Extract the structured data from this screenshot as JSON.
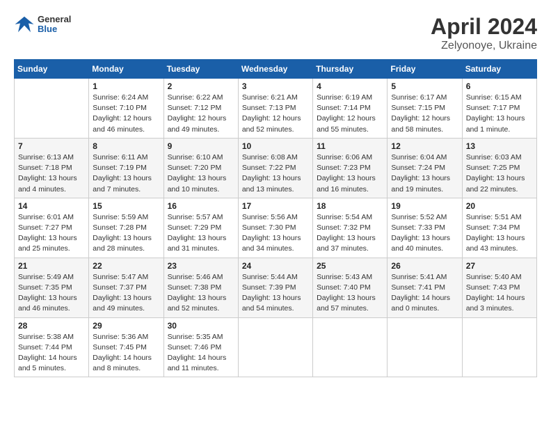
{
  "header": {
    "logo_line1": "General",
    "logo_line2": "Blue",
    "title": "April 2024",
    "subtitle": "Zelyonoye, Ukraine"
  },
  "weekdays": [
    "Sunday",
    "Monday",
    "Tuesday",
    "Wednesday",
    "Thursday",
    "Friday",
    "Saturday"
  ],
  "weeks": [
    [
      {
        "num": "",
        "detail": ""
      },
      {
        "num": "1",
        "detail": "Sunrise: 6:24 AM\nSunset: 7:10 PM\nDaylight: 12 hours\nand 46 minutes."
      },
      {
        "num": "2",
        "detail": "Sunrise: 6:22 AM\nSunset: 7:12 PM\nDaylight: 12 hours\nand 49 minutes."
      },
      {
        "num": "3",
        "detail": "Sunrise: 6:21 AM\nSunset: 7:13 PM\nDaylight: 12 hours\nand 52 minutes."
      },
      {
        "num": "4",
        "detail": "Sunrise: 6:19 AM\nSunset: 7:14 PM\nDaylight: 12 hours\nand 55 minutes."
      },
      {
        "num": "5",
        "detail": "Sunrise: 6:17 AM\nSunset: 7:15 PM\nDaylight: 12 hours\nand 58 minutes."
      },
      {
        "num": "6",
        "detail": "Sunrise: 6:15 AM\nSunset: 7:17 PM\nDaylight: 13 hours\nand 1 minute."
      }
    ],
    [
      {
        "num": "7",
        "detail": "Sunrise: 6:13 AM\nSunset: 7:18 PM\nDaylight: 13 hours\nand 4 minutes."
      },
      {
        "num": "8",
        "detail": "Sunrise: 6:11 AM\nSunset: 7:19 PM\nDaylight: 13 hours\nand 7 minutes."
      },
      {
        "num": "9",
        "detail": "Sunrise: 6:10 AM\nSunset: 7:20 PM\nDaylight: 13 hours\nand 10 minutes."
      },
      {
        "num": "10",
        "detail": "Sunrise: 6:08 AM\nSunset: 7:22 PM\nDaylight: 13 hours\nand 13 minutes."
      },
      {
        "num": "11",
        "detail": "Sunrise: 6:06 AM\nSunset: 7:23 PM\nDaylight: 13 hours\nand 16 minutes."
      },
      {
        "num": "12",
        "detail": "Sunrise: 6:04 AM\nSunset: 7:24 PM\nDaylight: 13 hours\nand 19 minutes."
      },
      {
        "num": "13",
        "detail": "Sunrise: 6:03 AM\nSunset: 7:25 PM\nDaylight: 13 hours\nand 22 minutes."
      }
    ],
    [
      {
        "num": "14",
        "detail": "Sunrise: 6:01 AM\nSunset: 7:27 PM\nDaylight: 13 hours\nand 25 minutes."
      },
      {
        "num": "15",
        "detail": "Sunrise: 5:59 AM\nSunset: 7:28 PM\nDaylight: 13 hours\nand 28 minutes."
      },
      {
        "num": "16",
        "detail": "Sunrise: 5:57 AM\nSunset: 7:29 PM\nDaylight: 13 hours\nand 31 minutes."
      },
      {
        "num": "17",
        "detail": "Sunrise: 5:56 AM\nSunset: 7:30 PM\nDaylight: 13 hours\nand 34 minutes."
      },
      {
        "num": "18",
        "detail": "Sunrise: 5:54 AM\nSunset: 7:32 PM\nDaylight: 13 hours\nand 37 minutes."
      },
      {
        "num": "19",
        "detail": "Sunrise: 5:52 AM\nSunset: 7:33 PM\nDaylight: 13 hours\nand 40 minutes."
      },
      {
        "num": "20",
        "detail": "Sunrise: 5:51 AM\nSunset: 7:34 PM\nDaylight: 13 hours\nand 43 minutes."
      }
    ],
    [
      {
        "num": "21",
        "detail": "Sunrise: 5:49 AM\nSunset: 7:35 PM\nDaylight: 13 hours\nand 46 minutes."
      },
      {
        "num": "22",
        "detail": "Sunrise: 5:47 AM\nSunset: 7:37 PM\nDaylight: 13 hours\nand 49 minutes."
      },
      {
        "num": "23",
        "detail": "Sunrise: 5:46 AM\nSunset: 7:38 PM\nDaylight: 13 hours\nand 52 minutes."
      },
      {
        "num": "24",
        "detail": "Sunrise: 5:44 AM\nSunset: 7:39 PM\nDaylight: 13 hours\nand 54 minutes."
      },
      {
        "num": "25",
        "detail": "Sunrise: 5:43 AM\nSunset: 7:40 PM\nDaylight: 13 hours\nand 57 minutes."
      },
      {
        "num": "26",
        "detail": "Sunrise: 5:41 AM\nSunset: 7:41 PM\nDaylight: 14 hours\nand 0 minutes."
      },
      {
        "num": "27",
        "detail": "Sunrise: 5:40 AM\nSunset: 7:43 PM\nDaylight: 14 hours\nand 3 minutes."
      }
    ],
    [
      {
        "num": "28",
        "detail": "Sunrise: 5:38 AM\nSunset: 7:44 PM\nDaylight: 14 hours\nand 5 minutes."
      },
      {
        "num": "29",
        "detail": "Sunrise: 5:36 AM\nSunset: 7:45 PM\nDaylight: 14 hours\nand 8 minutes."
      },
      {
        "num": "30",
        "detail": "Sunrise: 5:35 AM\nSunset: 7:46 PM\nDaylight: 14 hours\nand 11 minutes."
      },
      {
        "num": "",
        "detail": ""
      },
      {
        "num": "",
        "detail": ""
      },
      {
        "num": "",
        "detail": ""
      },
      {
        "num": "",
        "detail": ""
      }
    ]
  ]
}
